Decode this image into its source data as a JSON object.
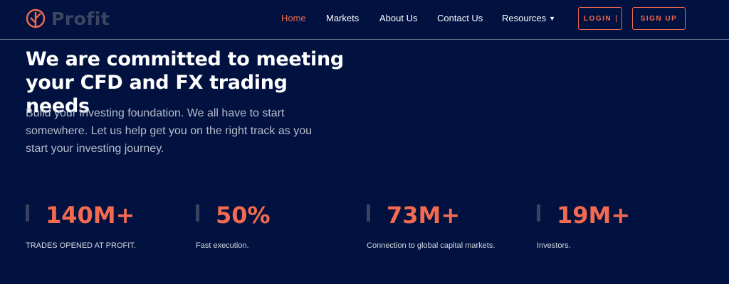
{
  "brand": {
    "name": "Profit",
    "accent_color": "#f26a4f",
    "background_color": "#011240",
    "logo_icon": "profit-logo-icon"
  },
  "nav": {
    "items": [
      {
        "label": "Home",
        "active": true
      },
      {
        "label": "Markets",
        "active": false
      },
      {
        "label": "About Us",
        "active": false
      },
      {
        "label": "Contact Us",
        "active": false
      },
      {
        "label": "Resources",
        "active": false,
        "icon": "chevron-down-icon"
      }
    ],
    "login_label": "LOGIN",
    "signup_label": "SIGN UP"
  },
  "hero": {
    "title": "We are committed to meeting your CFD and FX trading needs",
    "subtitle": "Build your investing foundation. We all have to start somewhere. Let us help get you on the right track as you start your investing journey."
  },
  "stats": [
    {
      "value": "140M+",
      "label": "TRADES OPENED AT PROFIT."
    },
    {
      "value": "50%",
      "label": "Fast execution."
    },
    {
      "value": "73M+",
      "label": "Connection to global capital markets."
    },
    {
      "value": "19M+",
      "label": "Investors."
    }
  ]
}
